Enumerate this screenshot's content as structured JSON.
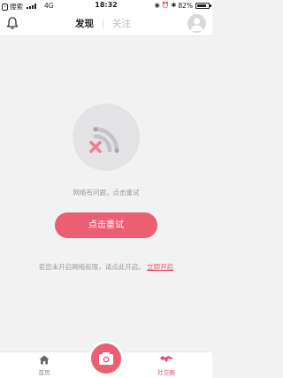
{
  "status_bar": {
    "back_app": "搜索",
    "network": "4G",
    "time": "18:32",
    "battery": "82%"
  },
  "header": {
    "tabs": [
      "发现",
      "关注"
    ],
    "active_tab": "发现"
  },
  "error": {
    "message": "网络有问题，点击重试",
    "retry_label": "点击重试",
    "permission_text": "若您未开启网络权限，请点此开启。",
    "permission_link": "立即开启"
  },
  "bottom_nav": {
    "items": [
      {
        "label": "首页",
        "icon": "home-icon"
      },
      {
        "label": "",
        "icon": "camera-icon"
      },
      {
        "label": "社交圈",
        "icon": "social-circle-icon"
      }
    ],
    "active": "社交圈"
  },
  "colors": {
    "accent": "#ec5e72",
    "link": "#e8506a",
    "background": "#f2f2f2"
  }
}
